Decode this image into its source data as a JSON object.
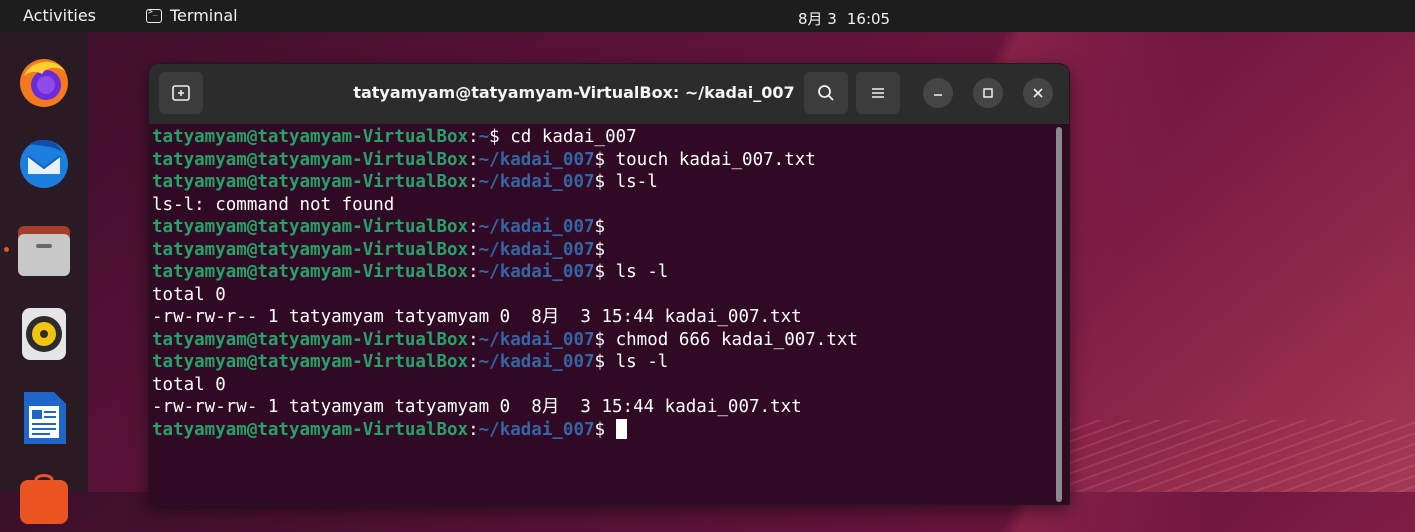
{
  "topbar": {
    "activities": "Activities",
    "app_name": "Terminal",
    "date": "8月 3",
    "time": "16:05"
  },
  "dock": {
    "items": [
      {
        "name": "firefox-icon"
      },
      {
        "name": "thunderbird-icon"
      },
      {
        "name": "files-icon"
      },
      {
        "name": "rhythmbox-icon"
      },
      {
        "name": "libreoffice-writer-icon"
      },
      {
        "name": "software-center-icon"
      }
    ]
  },
  "window": {
    "title": "tatyamyam@tatyamyam-VirtualBox: ~/kadai_007"
  },
  "terminal": {
    "user_host": "tatyamyam@tatyamyam-VirtualBox",
    "lines": [
      {
        "type": "prompt",
        "path": "~",
        "cmd": " cd kadai_007"
      },
      {
        "type": "prompt",
        "path": "~/kadai_007",
        "cmd": " touch kadai_007.txt"
      },
      {
        "type": "prompt",
        "path": "~/kadai_007",
        "cmd": " ls-l"
      },
      {
        "type": "out",
        "text": "ls-l: command not found"
      },
      {
        "type": "prompt",
        "path": "~/kadai_007",
        "cmd": ""
      },
      {
        "type": "prompt",
        "path": "~/kadai_007",
        "cmd": ""
      },
      {
        "type": "prompt",
        "path": "~/kadai_007",
        "cmd": " ls -l"
      },
      {
        "type": "out",
        "text": "total 0"
      },
      {
        "type": "out",
        "text": "-rw-rw-r-- 1 tatyamyam tatyamyam 0  8月  3 15:44 kadai_007.txt"
      },
      {
        "type": "prompt",
        "path": "~/kadai_007",
        "cmd": " chmod 666 kadai_007.txt"
      },
      {
        "type": "prompt",
        "path": "~/kadai_007",
        "cmd": " ls -l"
      },
      {
        "type": "out",
        "text": "total 0"
      },
      {
        "type": "out",
        "text": "-rw-rw-rw- 1 tatyamyam tatyamyam 0  8月  3 15:44 kadai_007.txt"
      },
      {
        "type": "prompt",
        "path": "~/kadai_007",
        "cmd": "",
        "cursor": true
      }
    ]
  }
}
